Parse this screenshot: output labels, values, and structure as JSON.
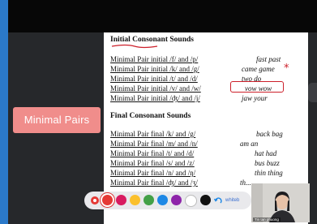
{
  "sidebar": {
    "pill_label": "Minimal Pairs"
  },
  "document": {
    "initial_heading": "Initial Consonant Sounds",
    "final_heading": "Final Consonant Sounds",
    "initial_pairs": [
      {
        "label": "Minimal Pair initial /f/ and /p/",
        "words": "fast past"
      },
      {
        "label": "Minimal Pair initial /k/ and /g/",
        "words": "came game"
      },
      {
        "label": "Minimal Pair initial /t/ and /d/",
        "words": "two do"
      },
      {
        "label": "Minimal Pair initial /v/ and /w/",
        "words": "vow wow"
      },
      {
        "label": "Minimal Pair initial /ʤ/ and /j/",
        "words": "jaw your"
      }
    ],
    "final_pairs": [
      {
        "label": "Minimal Pair final /k/ and /g/",
        "words": "back bag"
      },
      {
        "label": "Minimal Pair final /m/ and /n/",
        "words": "am an"
      },
      {
        "label": "Minimal Pair final /t/ and /d/",
        "words": "hat had"
      },
      {
        "label": "Minimal Pair final /s/ and /z/",
        "words": "bus buzz"
      },
      {
        "label": "Minimal Pair final /n/ and /ŋ/",
        "words": "thin thing"
      },
      {
        "label": "Minimal Pair final /ʤ/ and /ʒ/",
        "words": "th..."
      }
    ],
    "annotation_color": "#cc1f2a"
  },
  "toolbar": {
    "colors": [
      "#e53935",
      "#d81b60",
      "#fbc02d",
      "#43a047",
      "#1e88e5",
      "#8e24aa",
      "#ffffff",
      "#111111"
    ],
    "selected_color_index": 0,
    "icons": [
      "pen-icon",
      "undo-icon"
    ],
    "text_label": "whiteb"
  },
  "video": {
    "participant_name": "Tin tan phuong"
  }
}
